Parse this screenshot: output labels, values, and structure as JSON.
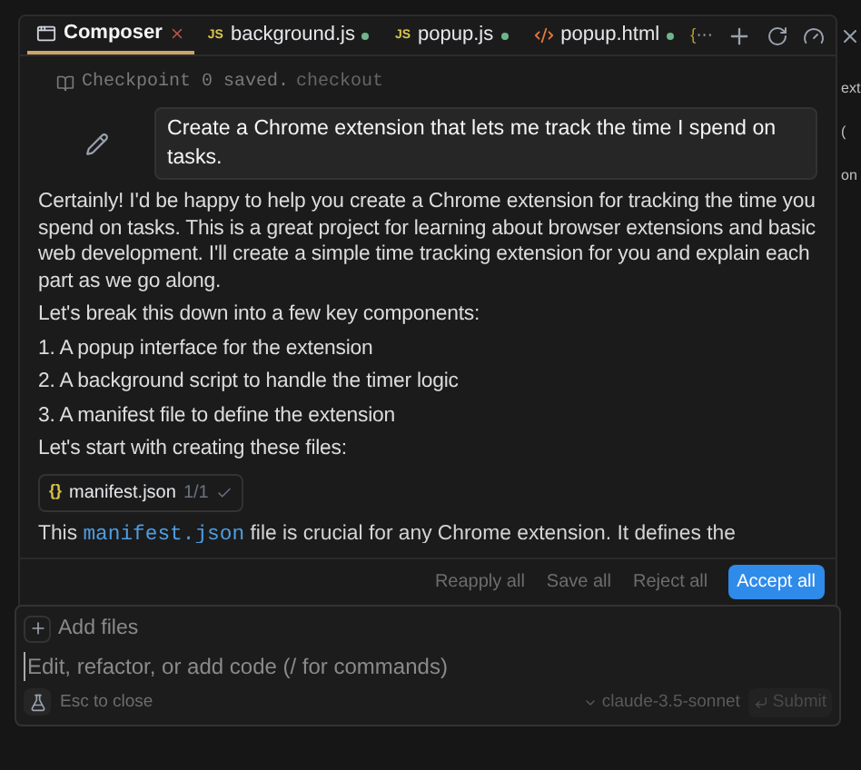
{
  "tabs": [
    {
      "label": "Composer",
      "kind": "composer",
      "selected": true
    },
    {
      "label": "background.js",
      "kind": "js",
      "icon": "JS",
      "selected": false
    },
    {
      "label": "popup.js",
      "kind": "js",
      "icon": "JS",
      "selected": false
    },
    {
      "label": "popup.html",
      "kind": "html",
      "selected": false
    }
  ],
  "cut_tab_icon": "{",
  "more": "···",
  "checkpoint": {
    "text": "Checkpoint 0 saved.",
    "link": "checkout"
  },
  "user_message": "Create a Chrome extension that lets me track the time I spend on tasks.",
  "assistant": {
    "paragraphs": [
      "Certainly! I'd be happy to help you create a Chrome extension for tracking the time you spend on tasks. This is a great project for learning about browser extensions and basic web development. I'll create a simple time tracking extension for you and explain each part as we go along.",
      "Let's break this down into a few key components:",
      "1. A popup interface for the extension",
      "2. A background script to handle the timer logic",
      "3. A manifest file to define the extension",
      "Let's start with creating these files:"
    ],
    "file_chip": {
      "icon": "{}",
      "name": "manifest.json",
      "count": "1/1"
    },
    "cut_line": {
      "before": "This",
      "code": "manifest.json",
      "after": "file is crucial for any Chrome extension. It defines the"
    }
  },
  "actions": [
    {
      "label": "Reapply all",
      "primary": false
    },
    {
      "label": "Save all",
      "primary": false
    },
    {
      "label": "Reject all",
      "primary": false
    },
    {
      "label": "Accept all",
      "primary": true
    }
  ],
  "input": {
    "add_files": "Add files",
    "placeholder": "Edit, refactor, or add code (/ for commands)",
    "esc": "Esc to close",
    "model": "claude-3.5-sonnet",
    "submit": "Submit"
  },
  "background_fragments": [
    "ext",
    "(",
    "on"
  ]
}
